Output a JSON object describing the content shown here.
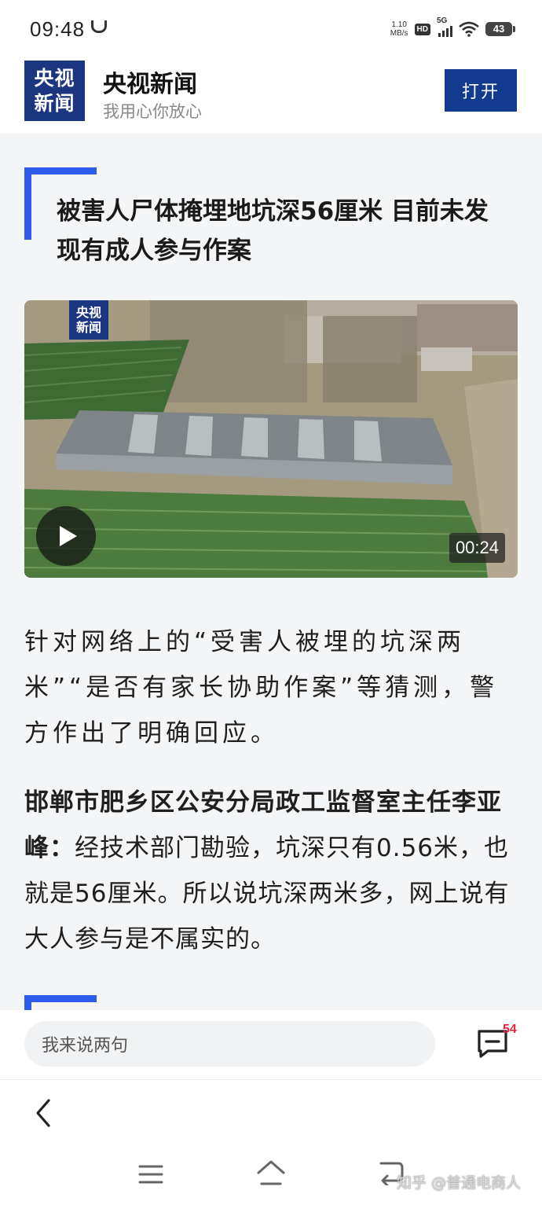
{
  "status_bar": {
    "time": "09:48",
    "net_speed_value": "1.10",
    "net_speed_unit": "MB/s",
    "hd_label": "HD",
    "signal_label": "5G",
    "battery": "43"
  },
  "app_header": {
    "logo_line1": "央视",
    "logo_line2": "新闻",
    "app_name": "央视新闻",
    "slogan": "我用心你放心",
    "open_button": "打开"
  },
  "article": {
    "headline": "被害人尸体掩埋地坑深56厘米 目前未发现有成人参与作案",
    "video": {
      "watermark_line1": "央视",
      "watermark_line2": "新闻",
      "duration": "00:24"
    },
    "para1": "针对网络上的“受害人被埋的坑深两米”“是否有家长协助作案”等猜测，警方作出了明确回应。",
    "para2_speaker": "邯郸市肥乡区公安分局政工监督室主任李亚峰：",
    "para2_text": "经技术部门勘验，坑深只有0.56米，也就是56厘米。所以说坑深两米多，网上说有大人参与是不属实的。"
  },
  "comment_bar": {
    "placeholder": "我来说两句",
    "count": "54"
  },
  "watermark": "知乎 @普通电商人",
  "colors": {
    "brand_blue": "#1b3680",
    "accent_blue": "#2f5bec",
    "button_blue": "#123b8f",
    "badge_red": "#e3243b"
  }
}
